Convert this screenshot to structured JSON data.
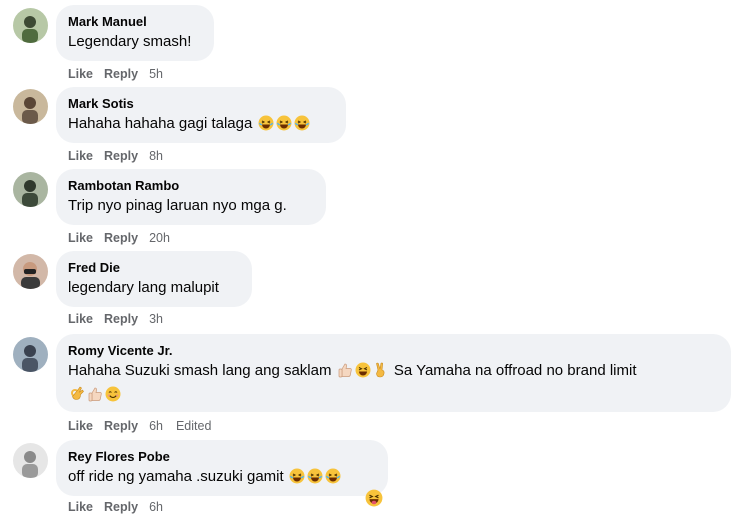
{
  "comments": [
    {
      "name": "Mark Manuel",
      "text": "Legendary smash!",
      "like": "Like",
      "reply": "Reply",
      "time": "5h",
      "avatar_color": "#5b7f4a"
    },
    {
      "name": "Mark Sotis",
      "text": "Hahaha hahaha gagi talaga",
      "like": "Like",
      "reply": "Reply",
      "time": "8h",
      "avatar_color": "#7a6b5a"
    },
    {
      "name": "Rambotan Rambo",
      "text": "Trip nyo pinag laruan nyo mga g.",
      "like": "Like",
      "reply": "Reply",
      "time": "20h",
      "avatar_color": "#4d5b4a"
    },
    {
      "name": "Fred Die",
      "text": "legendary lang malupit",
      "like": "Like",
      "reply": "Reply",
      "time": "3h",
      "avatar_color": "#8a5a4a"
    },
    {
      "name": "Romy Vicente Jr.",
      "text_a": "Hahaha Suzuki smash lang ang saklam",
      "text_b": "Sa Yamaha na offroad no brand limit",
      "like": "Like",
      "reply": "Reply",
      "time": "6h",
      "edited": "Edited",
      "avatar_color": "#4a5a6a"
    },
    {
      "name": "Rey Flores Pobe",
      "text": "off ride ng yamaha .suzuki gamit",
      "like": "Like",
      "reply": "Reply",
      "time": "6h",
      "avatar_color": "#9a9a9a"
    }
  ],
  "colors": {
    "bubble": "#f0f2f5",
    "meta_text": "#65676b",
    "emoji_yellow": "#f7c33b"
  },
  "icons": [
    "laughing-emoji",
    "grinning-squint-emoji",
    "thumbs-up-emoji",
    "victory-hand-emoji",
    "ok-hand-emoji",
    "smiling-emoji",
    "winking-tongue-emoji"
  ]
}
